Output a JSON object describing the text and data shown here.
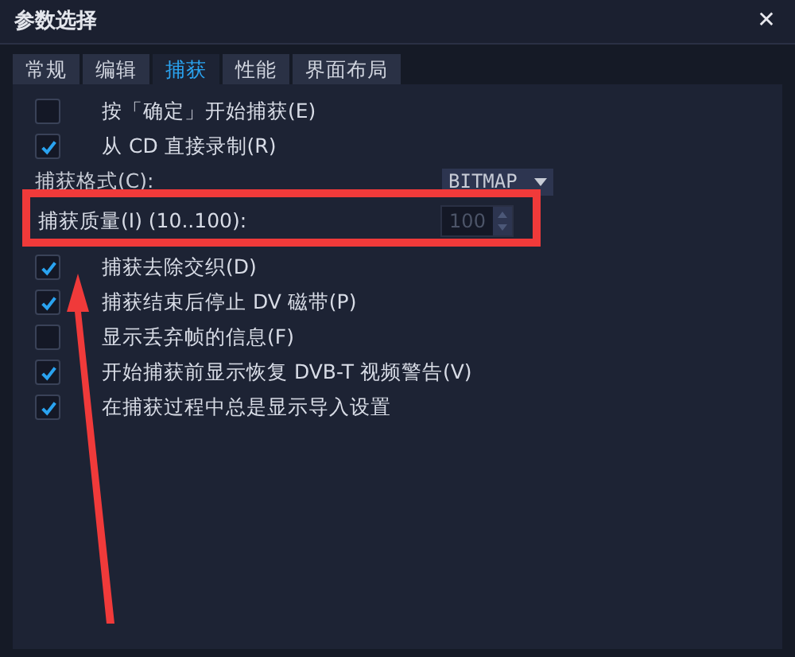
{
  "window": {
    "title": "参数选择",
    "close": "✕"
  },
  "tabs": [
    {
      "label": "常规",
      "selected": false
    },
    {
      "label": "编辑",
      "selected": false
    },
    {
      "label": "捕获",
      "selected": true
    },
    {
      "label": "性能",
      "selected": false
    },
    {
      "label": "界面布局",
      "selected": false
    }
  ],
  "options_top": [
    {
      "label": "按「确定」开始捕获(E)",
      "checked": false
    },
    {
      "label": "从 CD 直接录制(R)",
      "checked": true
    }
  ],
  "capture_format": {
    "label": "捕获格式(C):",
    "value": "BITMAP"
  },
  "capture_quality": {
    "label": "捕获质量(I) (10..100):",
    "value": "100",
    "disabled": true
  },
  "options_bottom": [
    {
      "label": "捕获去除交织(D)",
      "checked": true
    },
    {
      "label": "捕获结束后停止 DV 磁带(P)",
      "checked": true
    },
    {
      "label": "显示丢弃帧的信息(F)",
      "checked": false
    },
    {
      "label": "开始捕获前显示恢复 DVB-T 视频警告(V)",
      "checked": true
    },
    {
      "label": "在捕获过程中总是显示导入设置",
      "checked": true
    }
  ]
}
